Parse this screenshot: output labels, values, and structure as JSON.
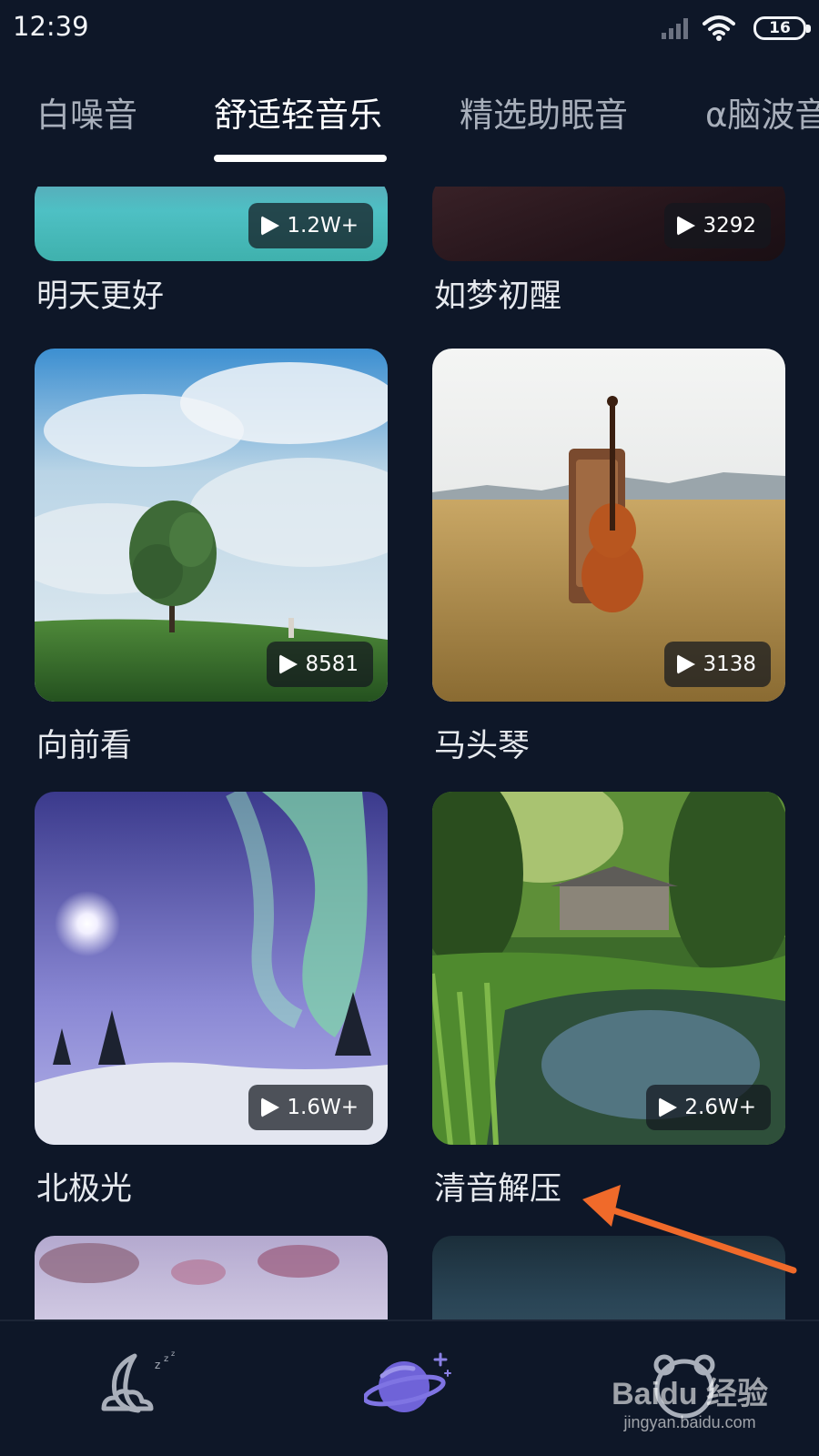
{
  "status_bar": {
    "time": "12:39",
    "battery": "16"
  },
  "tabs": [
    {
      "label": "白噪音",
      "active": false
    },
    {
      "label": "舒适轻音乐",
      "active": true
    },
    {
      "label": "精选助眠音",
      "active": false
    },
    {
      "label": "α脑波音",
      "active": false
    }
  ],
  "cards": [
    {
      "title": "明天更好",
      "plays": "1.2W+"
    },
    {
      "title": "如梦初醒",
      "plays": "3292"
    },
    {
      "title": "向前看",
      "plays": "8581"
    },
    {
      "title": "马头琴",
      "plays": "3138"
    },
    {
      "title": "北极光",
      "plays": "1.6W+"
    },
    {
      "title": "清音解压",
      "plays": "2.6W+"
    }
  ],
  "bottom_nav": [
    {
      "icon": "moon-sleep-icon",
      "active": false
    },
    {
      "icon": "planet-icon",
      "active": true
    },
    {
      "icon": "bear-icon",
      "active": false
    }
  ],
  "watermark": {
    "logo": "Baidu 经验",
    "url": "jingyan.baidu.com"
  },
  "colors": {
    "background": "#0e1728",
    "accent": "#6f63d8",
    "annotation_arrow": "#f06a2a"
  }
}
